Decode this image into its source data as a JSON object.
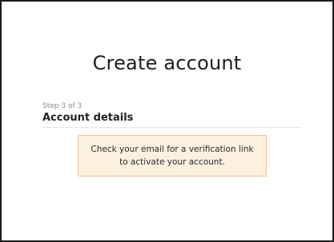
{
  "page": {
    "title": "Create account"
  },
  "step": {
    "indicator": "Step 3 of 3",
    "section_title": "Account details"
  },
  "notice": {
    "line1": "Check your email for a verification link",
    "line2": "to activate your account."
  },
  "colors": {
    "notice_background": "#fcf0df",
    "notice_border": "#ecc48f",
    "frame_border": "#1b1b1b"
  }
}
